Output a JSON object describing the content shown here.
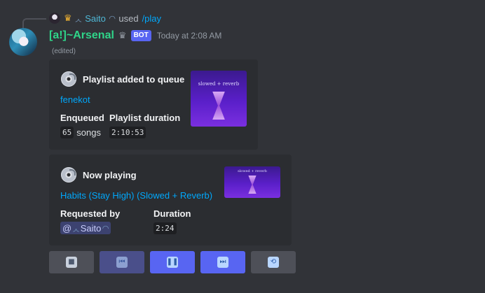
{
  "reply": {
    "user": "Saito",
    "used_text": "used",
    "command": "/play"
  },
  "message": {
    "username": "[a!]~Arsenal",
    "bot_tag": "BOT",
    "timestamp": "Today at 2:08 AM",
    "edited": "(edited)"
  },
  "embed_queue": {
    "title": "Playlist added to queue",
    "link": "fenekot",
    "field1_name": "Enqueued",
    "field1_count": "65",
    "field1_unit": "songs",
    "field2_name": "Playlist duration",
    "field2_value": "2:10:53",
    "thumb_text": "slowed + reverb"
  },
  "embed_playing": {
    "title": "Now playing",
    "link": "Habits (Stay High) (Slowed + Reverb)",
    "field1_name": "Requested by",
    "mention_at": "@",
    "mention_user": "Saito",
    "field2_name": "Duration",
    "field2_value": "2:24",
    "thumb_text": "slowed + reverb"
  },
  "buttons": [
    {
      "name": "stop",
      "icon": "stop-icon",
      "style": "secondary"
    },
    {
      "name": "previous",
      "icon": "previous-icon",
      "style": "primary-disabled"
    },
    {
      "name": "pause",
      "icon": "pause-icon",
      "style": "primary"
    },
    {
      "name": "skip",
      "icon": "skip-icon",
      "style": "primary"
    },
    {
      "name": "loop",
      "icon": "loop-icon",
      "style": "secondary"
    }
  ],
  "colors": {
    "background": "#313338",
    "embed": "#2b2d31",
    "username": "#2fd589",
    "link": "#00a8fc",
    "blurple": "#5865f2",
    "secondary_button": "#4e5058"
  }
}
